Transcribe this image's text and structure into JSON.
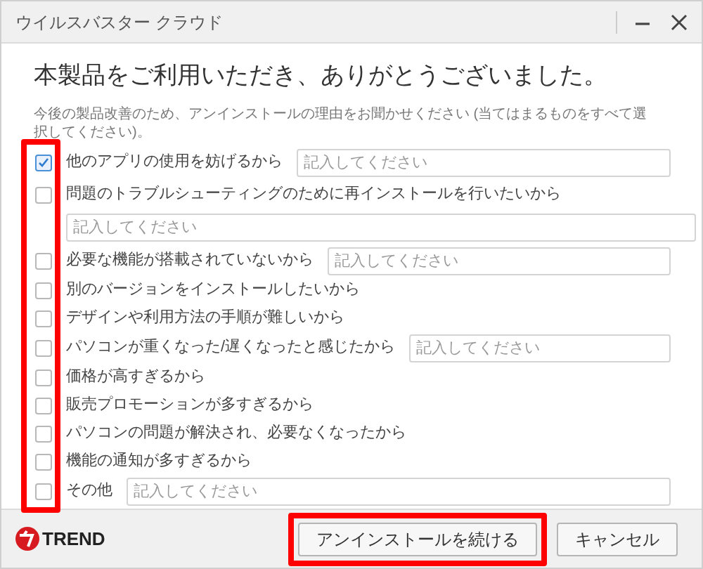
{
  "window": {
    "title": "ウイルスバスター クラウド"
  },
  "heading": "本製品をご利用いただき、ありがとうございました。",
  "instructions": "今後の製品改善のため、アンインストールの理由をお聞かせください (当てはまるものをすべて選択してください)。",
  "reasons": [
    {
      "kind": "inline_field",
      "label": "他のアプリの使用を妨げるから",
      "checked": true,
      "placeholder": "記入してください"
    },
    {
      "kind": "field_below",
      "label": "問題のトラブルシューティングのために再インストールを行いたいから",
      "checked": false,
      "placeholder": "記入してください"
    },
    {
      "kind": "inline_field",
      "label": "必要な機能が搭載されていないから",
      "checked": false,
      "placeholder": "記入してください"
    },
    {
      "kind": "plain",
      "label": "別のバージョンをインストールしたいから",
      "checked": false
    },
    {
      "kind": "plain",
      "label": "デザインや利用方法の手順が難しいから",
      "checked": false
    },
    {
      "kind": "inline_field",
      "label": "パソコンが重くなった/遅くなったと感じたから",
      "checked": false,
      "placeholder": "記入してください"
    },
    {
      "kind": "plain",
      "label": "価格が高すぎるから",
      "checked": false
    },
    {
      "kind": "plain",
      "label": "販売プロモーションが多すぎるから",
      "checked": false
    },
    {
      "kind": "plain",
      "label": "パソコンの問題が解決され、必要なくなったから",
      "checked": false
    },
    {
      "kind": "plain",
      "label": "機能の通知が多すぎるから",
      "checked": false
    },
    {
      "kind": "inline_field",
      "label": "その他",
      "checked": false,
      "placeholder": "記入してください"
    }
  ],
  "footer": {
    "logo_text": "TREND",
    "buttons": [
      {
        "label": "アンインストールを続ける",
        "highlighted": true
      },
      {
        "label": "キャンセル",
        "highlighted": false
      }
    ]
  },
  "checkbox_column_highlighted": true
}
